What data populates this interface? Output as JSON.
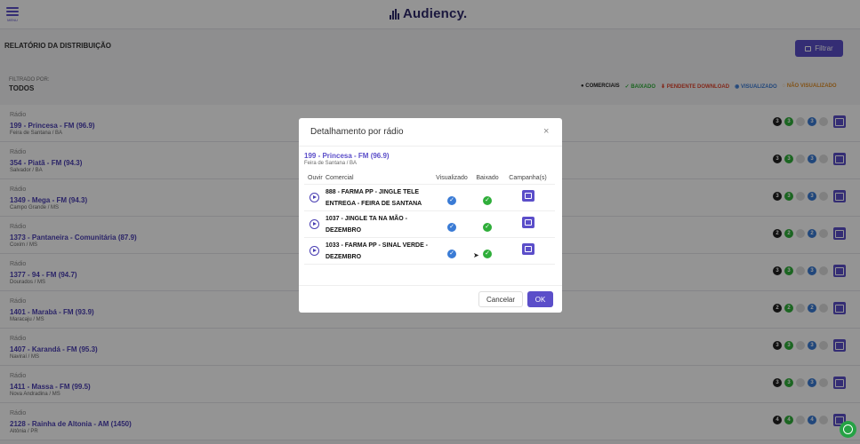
{
  "topbar": {
    "menu_label": "MENU",
    "brand": "Audiency."
  },
  "page": {
    "title": "RELATÓRIO DA DISTRIBUIÇÃO",
    "filter_button": "Filtrar",
    "filtered_by_label": "FILTRADO POR:",
    "filtered_by_value": "TODOS"
  },
  "legend": [
    {
      "label": "COMERCIAIS",
      "color": "#222222"
    },
    {
      "label": "BAIXADO",
      "color": "#2fae3a"
    },
    {
      "label": "PENDENTE DOWNLOAD",
      "color": "#e0462f"
    },
    {
      "label": "VISUALIZADO",
      "color": "#3a7bd5"
    },
    {
      "label": "NÃO VISUALIZADO",
      "color": "#e0902a"
    }
  ],
  "rows": [
    {
      "kind": "Rádio",
      "name": "199 - Princesa - FM (96.9)",
      "city": "Feira de Santana / BA",
      "comerciais": "3",
      "baixado": "3",
      "visualizado": "3"
    },
    {
      "kind": "Rádio",
      "name": "354 - Piatã - FM (94.3)",
      "city": "Salvador / BA",
      "comerciais": "3",
      "baixado": "3",
      "visualizado": "3"
    },
    {
      "kind": "Rádio",
      "name": "1349 - Mega - FM (94.3)",
      "city": "Campo Grande / MS",
      "comerciais": "3",
      "baixado": "3",
      "visualizado": "3"
    },
    {
      "kind": "Rádio",
      "name": "1373 - Pantaneira - Comunitária (87.9)",
      "city": "Coxim / MS",
      "comerciais": "2",
      "baixado": "2",
      "visualizado": "2"
    },
    {
      "kind": "Rádio",
      "name": "1377 - 94 - FM (94.7)",
      "city": "Dourados / MS",
      "comerciais": "3",
      "baixado": "3",
      "visualizado": "3"
    },
    {
      "kind": "Rádio",
      "name": "1401 - Marabá - FM (93.9)",
      "city": "Maracaju / MS",
      "comerciais": "2",
      "baixado": "2",
      "visualizado": "2"
    },
    {
      "kind": "Rádio",
      "name": "1407 - Karandá - FM (95.3)",
      "city": "Naviraí / MS",
      "comerciais": "3",
      "baixado": "3",
      "visualizado": "3"
    },
    {
      "kind": "Rádio",
      "name": "1411 - Massa - FM (99.5)",
      "city": "Nova Andradina / MS",
      "comerciais": "3",
      "baixado": "3",
      "visualizado": "3"
    },
    {
      "kind": "Rádio",
      "name": "2128 - Rainha de Altonia - AM (1450)",
      "city": "Altônia / PR",
      "comerciais": "4",
      "baixado": "4",
      "visualizado": "4"
    }
  ],
  "modal": {
    "title": "Detalhamento por rádio",
    "close": "×",
    "radio_name": "199 - Princesa - FM (96.9)",
    "radio_city": "Feira de Santana / BA",
    "columns": [
      "Ouvir",
      "Comercial",
      "Visualizado",
      "Baixado",
      "Campanha(s)"
    ],
    "items": [
      {
        "comercial": "888 - FARMA PP - JINGLE TELE ENTREGA - FEIRA DE SANTANA",
        "visualizado": "✓",
        "baixado": "✓"
      },
      {
        "comercial": "1037 - JINGLE TA NA MÃO - DEZEMBRO",
        "visualizado": "✓",
        "baixado": "✓"
      },
      {
        "comercial": "1033 - FARMA PP - SINAL VERDE - DEZEMBRO",
        "visualizado": "✓",
        "baixado": "✓"
      }
    ],
    "cancel": "Cancelar",
    "ok": "OK"
  }
}
